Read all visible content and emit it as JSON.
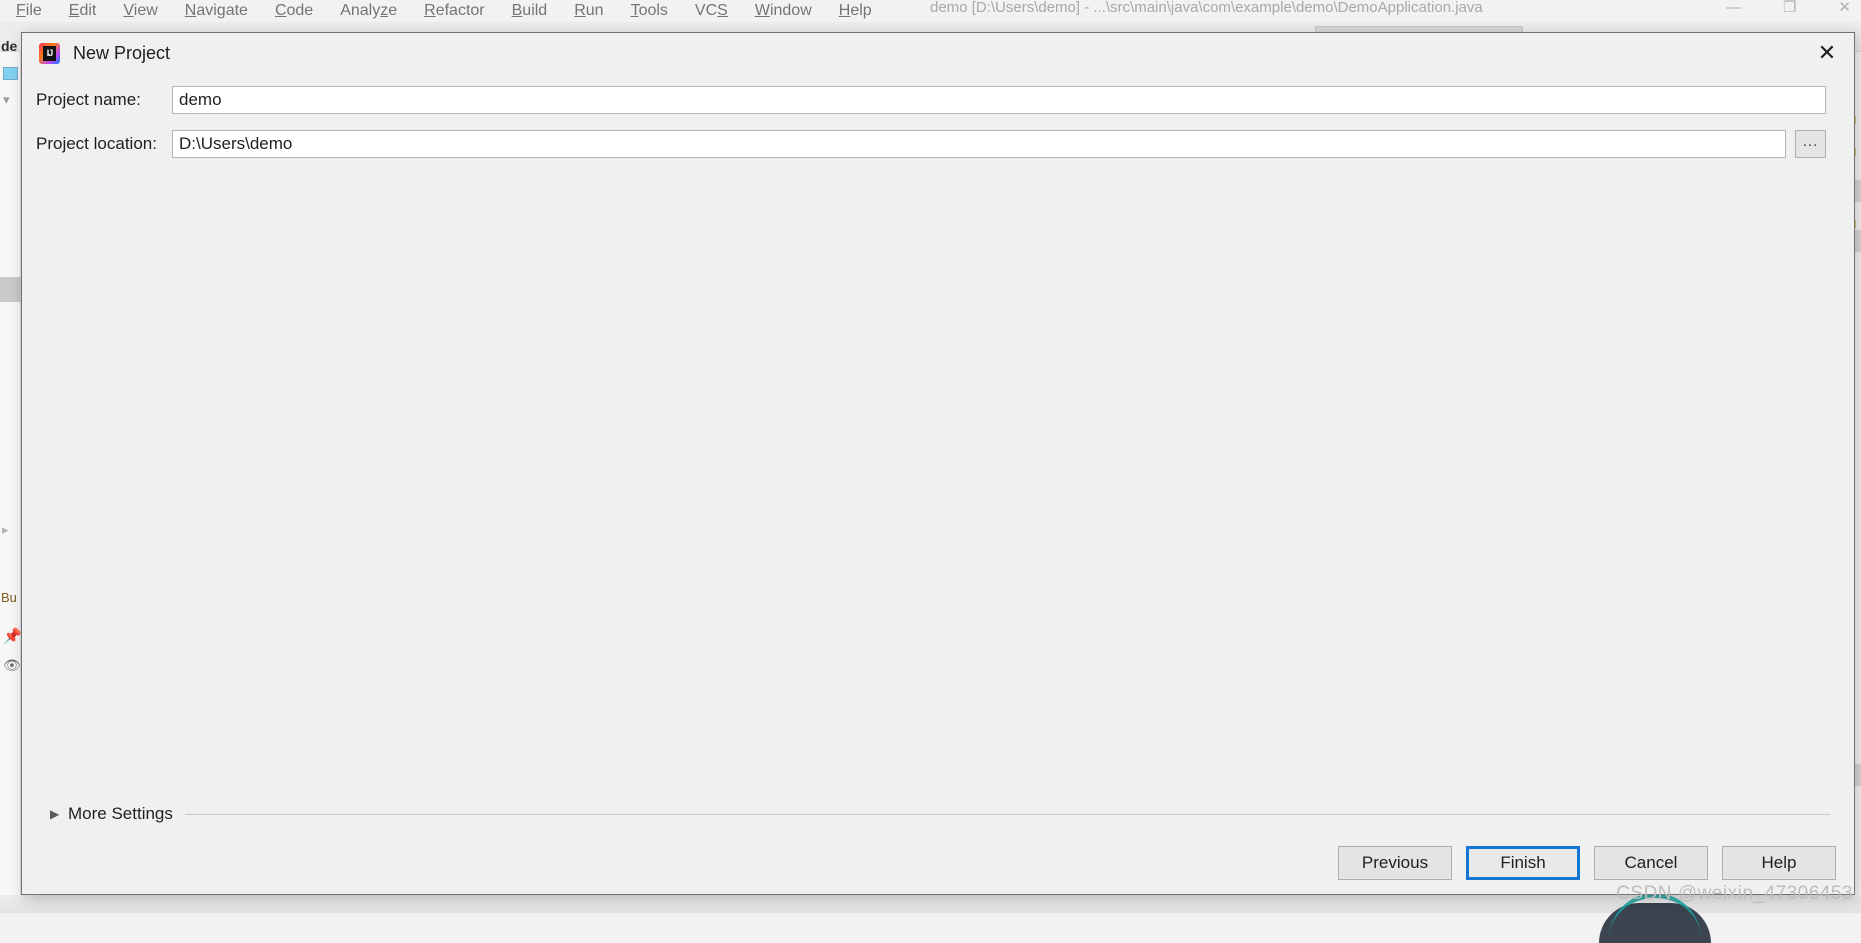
{
  "ide": {
    "window_title": "demo [D:\\Users\\demo] - ...\\src\\main\\java\\com\\example\\demo\\DemoApplication.java",
    "menu_items": [
      {
        "label": "File",
        "mnemonic": "F"
      },
      {
        "label": "Edit",
        "mnemonic": "E"
      },
      {
        "label": "View",
        "mnemonic": "V"
      },
      {
        "label": "Navigate",
        "mnemonic": "N"
      },
      {
        "label": "Code",
        "mnemonic": "C"
      },
      {
        "label": "Analyze",
        "mnemonic": "z"
      },
      {
        "label": "Refactor",
        "mnemonic": "R"
      },
      {
        "label": "Build",
        "mnemonic": "B"
      },
      {
        "label": "Run",
        "mnemonic": "R"
      },
      {
        "label": "Tools",
        "mnemonic": "T"
      },
      {
        "label": "VCS",
        "mnemonic": "S"
      },
      {
        "label": "Window",
        "mnemonic": "W"
      },
      {
        "label": "Help",
        "mnemonic": "H"
      }
    ],
    "window_controls": {
      "minimize": "—",
      "maximize": "❐",
      "close": "✕"
    },
    "left_strip": {
      "project_tab": "de",
      "build_tab": "Bu"
    }
  },
  "dialog": {
    "title": "New Project",
    "logo_text": "IJ",
    "close_glyph": "✕",
    "fields": [
      {
        "id": "project-name",
        "label": "Project name:",
        "value": "demo",
        "placeholder": ""
      },
      {
        "id": "project-location",
        "label": "Project location:",
        "value": "D:\\Users\\demo",
        "placeholder": ""
      }
    ],
    "browse_button_label": "...",
    "more_settings": {
      "label": "More Settings",
      "arrow": "▶",
      "expanded": false
    },
    "buttons": [
      {
        "label": "Previous",
        "focused": false
      },
      {
        "label": "Finish",
        "focused": true
      },
      {
        "label": "Cancel",
        "focused": false
      },
      {
        "label": "Help",
        "focused": false
      }
    ]
  },
  "watermark": "CSDN @weixin_47306453",
  "colors": {
    "focus_blue": "#1577d4",
    "dialog_bg": "#f0f0f0",
    "field_bg": "#ffffff",
    "button_bg": "#e4e4e4"
  }
}
